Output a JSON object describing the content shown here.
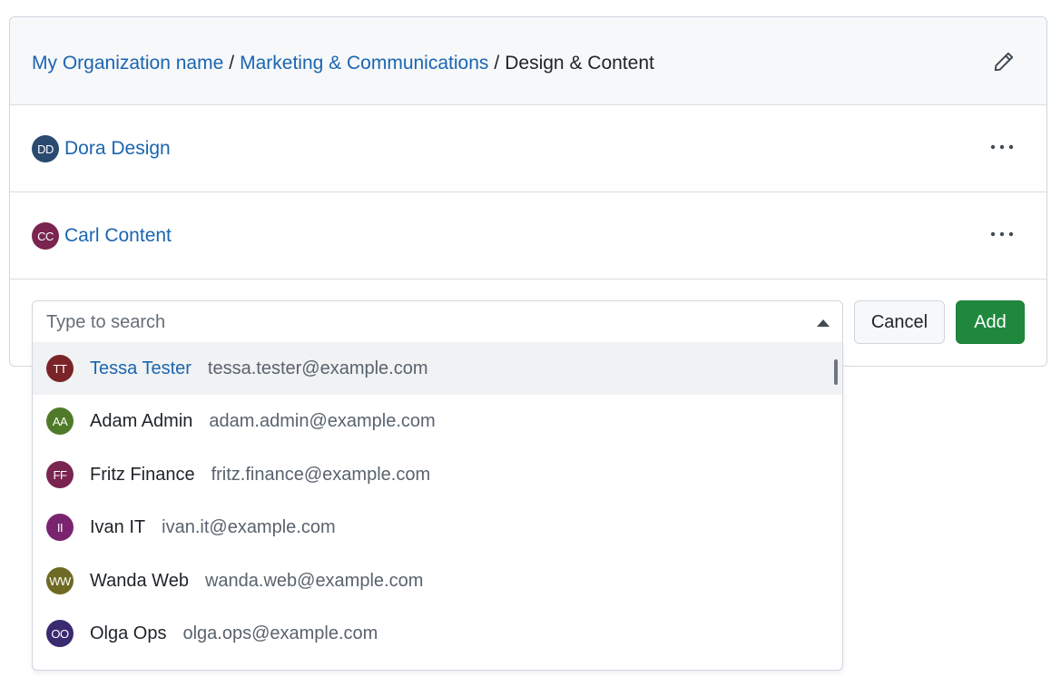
{
  "breadcrumb": {
    "org": "My Organization name",
    "separator": "/",
    "parent": "Marketing & Communications",
    "current": "Design & Content"
  },
  "members": [
    {
      "initials": "DD",
      "name": "Dora Design",
      "avatar_color": "#2a4a70"
    },
    {
      "initials": "CC",
      "name": "Carl Content",
      "avatar_color": "#7a2450"
    }
  ],
  "search": {
    "placeholder": "Type to search",
    "value": ""
  },
  "buttons": {
    "cancel_label": "Cancel",
    "add_label": "Add"
  },
  "dropdown": {
    "options": [
      {
        "initials": "TT",
        "name": "Tessa Tester",
        "email": "tessa.tester@example.com",
        "avatar_color": "#7a2428",
        "active": true
      },
      {
        "initials": "AA",
        "name": "Adam Admin",
        "email": "adam.admin@example.com",
        "avatar_color": "#4f7a2a",
        "active": false
      },
      {
        "initials": "FF",
        "name": "Fritz Finance",
        "email": "fritz.finance@example.com",
        "avatar_color": "#7a2450",
        "active": false
      },
      {
        "initials": "II",
        "name": "Ivan IT",
        "email": "ivan.it@example.com",
        "avatar_color": "#7a2470",
        "active": false
      },
      {
        "initials": "WW",
        "name": "Wanda Web",
        "email": "wanda.web@example.com",
        "avatar_color": "#6e6a24",
        "active": false
      },
      {
        "initials": "OO",
        "name": "Olga Ops",
        "email": "olga.ops@example.com",
        "avatar_color": "#3a2a70",
        "active": false
      }
    ]
  },
  "icons": {
    "edit": "pencil-icon",
    "more": "kebab-horizontal-icon",
    "caret": "triangle-up-icon"
  },
  "colors": {
    "link": "#1a65b0",
    "primary_button": "#1f883d",
    "header_bg": "#f6f8fa"
  }
}
